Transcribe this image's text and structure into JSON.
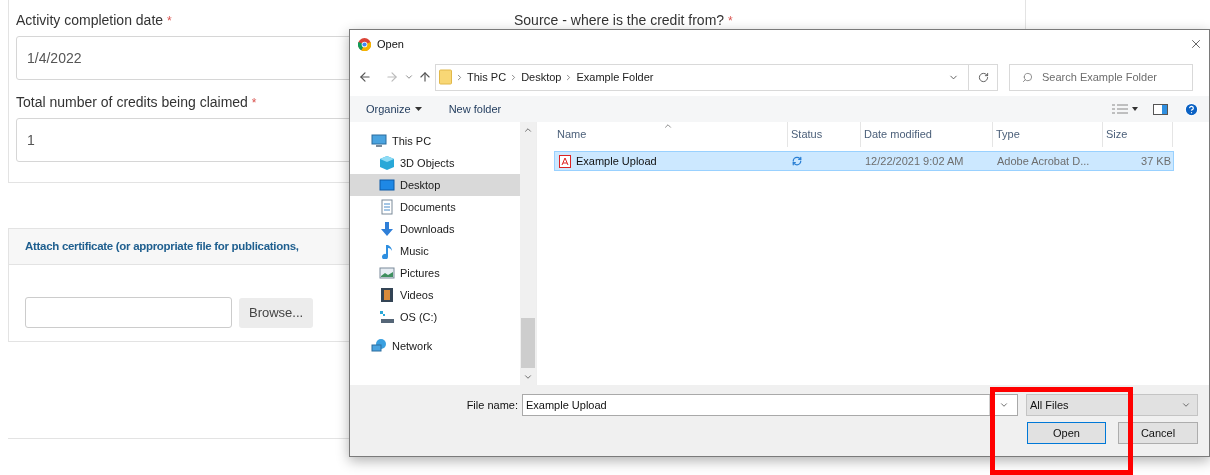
{
  "form": {
    "fields": [
      {
        "label": "Activity completion date",
        "required_mark": "*",
        "value": "1/4/2022"
      },
      {
        "label": "Total number of credits being claimed",
        "required_mark": "*",
        "value": "1"
      }
    ],
    "source_label": "Source - where is the credit from?",
    "source_required_mark": "*",
    "attach_panel": {
      "title": "Attach certificate (or appropriate file for publications,",
      "browse_button": "Browse..."
    }
  },
  "dialog": {
    "title": "Open",
    "breadcrumb": [
      "This PC",
      "Desktop",
      "Example Folder"
    ],
    "search": {
      "placeholder": "Search Example Folder"
    },
    "toolbar": [
      "Organize",
      "New folder"
    ],
    "nav": [
      {
        "label": "This PC",
        "kind": "pc",
        "selected": false,
        "children": [
          {
            "label": "3D Objects",
            "kind": "cube",
            "selected": false
          },
          {
            "label": "Desktop",
            "kind": "desktop",
            "selected": true
          },
          {
            "label": "Documents",
            "kind": "doc",
            "selected": false
          },
          {
            "label": "Downloads",
            "kind": "download",
            "selected": false
          },
          {
            "label": "Music",
            "kind": "music",
            "selected": false
          },
          {
            "label": "Pictures",
            "kind": "pictures",
            "selected": false
          },
          {
            "label": "Videos",
            "kind": "videos",
            "selected": false
          },
          {
            "label": "OS (C:)",
            "kind": "drive",
            "selected": false
          }
        ]
      },
      {
        "label": "Network",
        "kind": "network",
        "selected": false
      }
    ],
    "columns": [
      "Name",
      "Status",
      "Date modified",
      "Type",
      "Size"
    ],
    "files": [
      {
        "name": "Example Upload",
        "date": "12/22/2021 9:02 AM",
        "type": "Adobe Acrobat D...",
        "size": "37 KB",
        "selected": true
      }
    ],
    "file_name_label": "File name:",
    "file_name": "Example Upload",
    "filter": "All Files",
    "buttons": [
      "Open",
      "Cancel"
    ]
  }
}
